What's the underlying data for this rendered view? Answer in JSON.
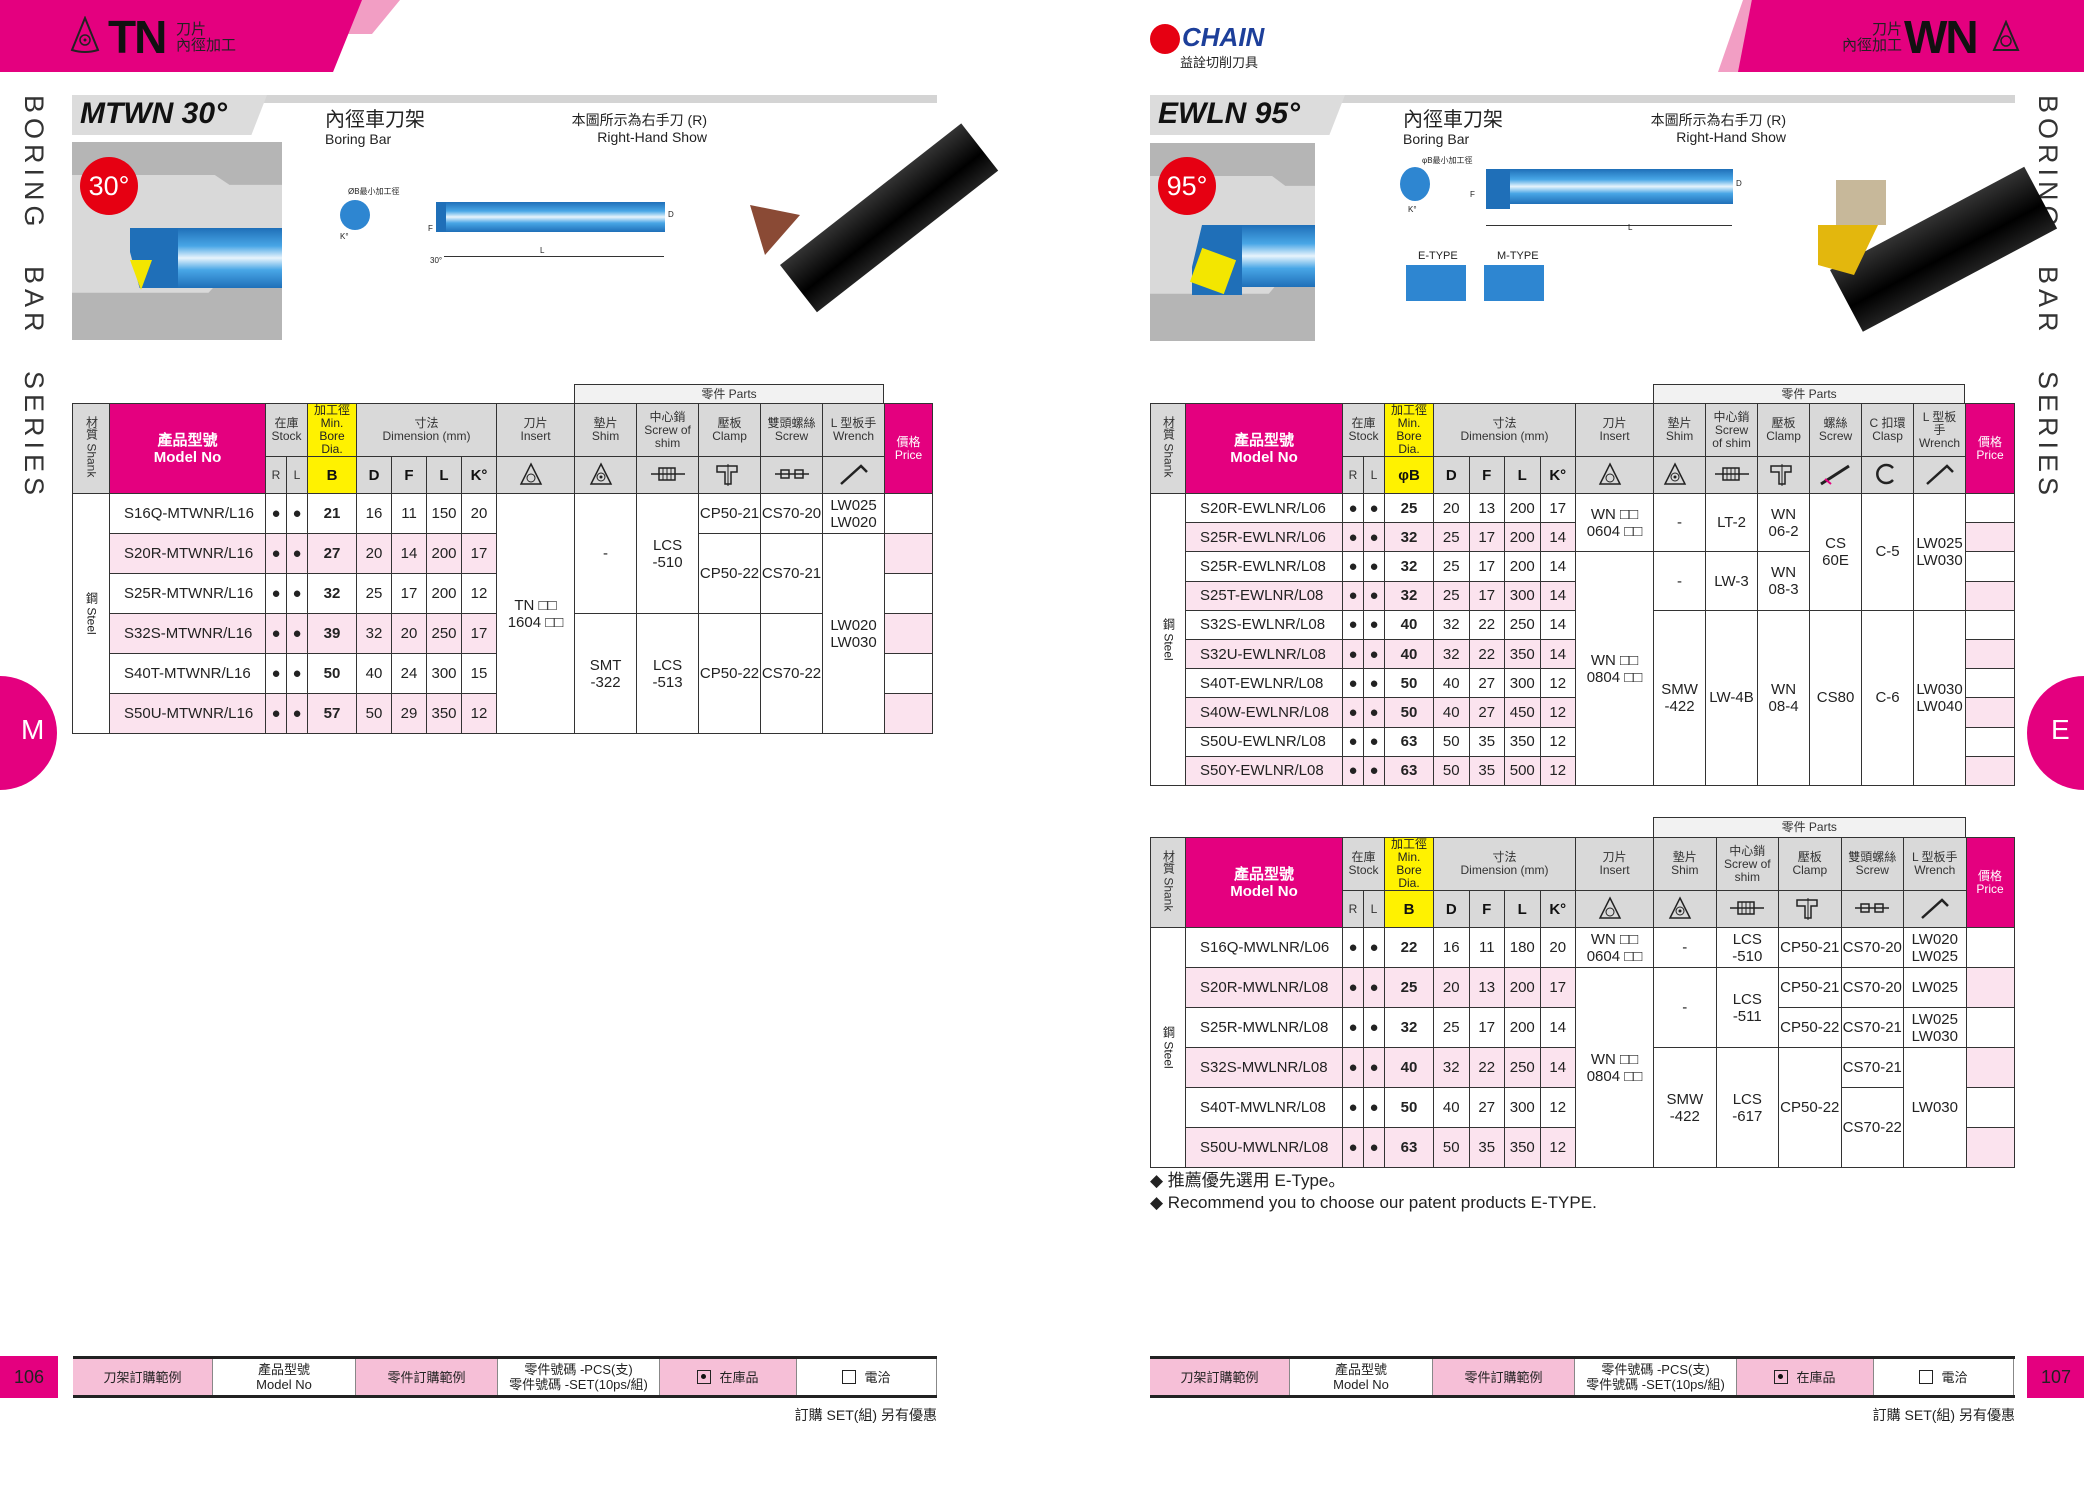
{
  "left_page": {
    "header": {
      "code": "TN",
      "line1": "刀片",
      "line2": "內徑加工",
      "icon": "tn-insert-triangle-icon"
    },
    "side_label": "BORING BAR SERIES",
    "section_letter": "M",
    "title": "MTWN 30°",
    "product_zh": "內徑車刀架",
    "product_en": "Boring Bar",
    "hand_zh": "本圖所示為右手刀 (R)",
    "hand_en": "Right-Hand Show",
    "angle_badge": "30°",
    "diagram": {
      "bore_note": "ØB最小加工徑",
      "d": "D",
      "f": "F",
      "l": "L",
      "k": "K°",
      "angle": "30°"
    },
    "page_number": "106"
  },
  "right_page": {
    "brand": {
      "name": "CHAIN",
      "tagline": "益詮切削刀具"
    },
    "header": {
      "code": "WN",
      "line1": "刀片",
      "line2": "內徑加工",
      "icon": "wn-insert-icon"
    },
    "side_label": "BORING BAR SERIES",
    "section_letter": "E",
    "title": "EWLN 95°",
    "product_zh": "內徑車刀架",
    "product_en": "Boring Bar",
    "hand_zh": "本圖所示為右手刀 (R)",
    "hand_en": "Right-Hand Show",
    "angle_badge": "95°",
    "diagram": {
      "bore_note": "φB最小加工徑",
      "d": "D",
      "f": "F",
      "l": "L",
      "k": "K°",
      "e_type": "E-TYPE",
      "m_type": "M-TYPE"
    },
    "notes": [
      "◆ 推薦優先選用 E-Type。",
      "◆ Recommend you to choose our patent products E-TYPE."
    ],
    "page_number": "107"
  },
  "footer": {
    "cells": [
      "刀架訂購範例",
      "產品型號\nModel No",
      "零件訂購範例",
      "零件號碼 -PCS(支)\n零件號碼 -SET(10ps/組)",
      "在庫品",
      "電洽"
    ],
    "set_note": "訂購 SET(組) 另有優惠"
  },
  "tables": [
    {
      "id": "mtwn",
      "header": {
        "shank": "材質 Shank",
        "model_zh": "產品型號",
        "model_en": "Model No",
        "stock": "在庫\nStock",
        "bore": "加工徑\nMin. Bore\nDia.",
        "dim": "寸法\nDimension (mm)",
        "insert": "刀片\nInsert",
        "r": "R",
        "l": "L",
        "b": "B",
        "d": "D",
        "f": "F",
        "L": "L",
        "k": "K°",
        "price": "價格\nPrice",
        "parts_label": "零件 Parts"
      },
      "parts_cols": [
        {
          "key": "shim",
          "label": "墊片\nShim",
          "icon": "shim-icon"
        },
        {
          "key": "screw_of_shim",
          "label": "中心銷\nScrew of\nshim",
          "icon": "shim-screw-icon"
        },
        {
          "key": "clamp",
          "label": "壓板\nClamp",
          "icon": "clamp-icon"
        },
        {
          "key": "screw",
          "label": "雙頭螺絲\nScrew",
          "icon": "double-screw-icon"
        },
        {
          "key": "wrench",
          "label": "L 型板手\nWrench",
          "icon": "wrench-icon"
        }
      ],
      "shank_body": "鋼 Steel",
      "rows": [
        {
          "model": "S16Q-MTWNR/L16",
          "r": "●",
          "l": "●",
          "b": "21",
          "d": "16",
          "f": "11",
          "L": "150",
          "k": "20"
        },
        {
          "model": "S20R-MTWNR/L16",
          "r": "●",
          "l": "●",
          "b": "27",
          "d": "20",
          "f": "14",
          "L": "200",
          "k": "17"
        },
        {
          "model": "S25R-MTWNR/L16",
          "r": "●",
          "l": "●",
          "b": "32",
          "d": "25",
          "f": "17",
          "L": "200",
          "k": "12"
        },
        {
          "model": "S32S-MTWNR/L16",
          "r": "●",
          "l": "●",
          "b": "39",
          "d": "32",
          "f": "20",
          "L": "250",
          "k": "17"
        },
        {
          "model": "S40T-MTWNR/L16",
          "r": "●",
          "l": "●",
          "b": "50",
          "d": "40",
          "f": "24",
          "L": "300",
          "k": "15"
        },
        {
          "model": "S50U-MTWNR/L16",
          "r": "●",
          "l": "●",
          "b": "57",
          "d": "50",
          "f": "29",
          "L": "350",
          "k": "12"
        }
      ],
      "insert": [
        {
          "value": "TN □□\n1604 □□",
          "span": 6
        }
      ],
      "parts": {
        "shim": [
          {
            "value": "-",
            "span": 3
          },
          {
            "value": "SMT\n-322",
            "span": 3
          }
        ],
        "screw_of_shim": [
          {
            "value": "LCS\n-510",
            "span": 3
          },
          {
            "value": "LCS\n-513",
            "span": 3
          }
        ],
        "clamp": [
          {
            "value": "CP50-21",
            "span": 1
          },
          {
            "value": "CP50-22",
            "span": 2
          },
          {
            "value": "CP50-22",
            "span": 3
          }
        ],
        "screw": [
          {
            "value": "CS70-20",
            "span": 1
          },
          {
            "value": "CS70-21",
            "span": 2
          },
          {
            "value": "CS70-22",
            "span": 3
          }
        ],
        "wrench": [
          {
            "value": "LW025\nLW020",
            "span": 1
          },
          {
            "value": "LW020\nLW030",
            "span": 5
          }
        ]
      }
    },
    {
      "id": "ewln",
      "header": {
        "shank": "材質 Shank",
        "model_zh": "產品型號",
        "model_en": "Model No",
        "stock": "在庫\nStock",
        "bore": "加工徑\nMin. Bore\nDia.",
        "dim": "寸法\nDimension (mm)",
        "insert": "刀片\nInsert",
        "r": "R",
        "l": "L",
        "b": "φB",
        "d": "D",
        "f": "F",
        "L": "L",
        "k": "K°",
        "price": "價格\nPrice",
        "parts_label": "零件 Parts"
      },
      "parts_cols": [
        {
          "key": "shim",
          "label": "墊片\nShim",
          "icon": "shim-icon"
        },
        {
          "key": "screw_of_shim",
          "label": "中心銷\nScrew\nof shim",
          "icon": "shim-screw-icon"
        },
        {
          "key": "clamp",
          "label": "壓板\nClamp",
          "icon": "clamp-icon"
        },
        {
          "key": "screw",
          "label": "螺絲\nScrew",
          "icon": "screw-icon"
        },
        {
          "key": "clasp",
          "label": "C 扣環\nClasp",
          "icon": "clasp-icon"
        },
        {
          "key": "wrench",
          "label": "L 型板\n手\nWrench",
          "icon": "wrench-icon"
        }
      ],
      "shank_body": "鋼 Steel",
      "rows": [
        {
          "model": "S20R-EWLNR/L06",
          "r": "●",
          "l": "●",
          "b": "25",
          "d": "20",
          "f": "13",
          "L": "200",
          "k": "17"
        },
        {
          "model": "S25R-EWLNR/L06",
          "r": "●",
          "l": "●",
          "b": "32",
          "d": "25",
          "f": "17",
          "L": "200",
          "k": "14"
        },
        {
          "model": "S25R-EWLNR/L08",
          "r": "●",
          "l": "●",
          "b": "32",
          "d": "25",
          "f": "17",
          "L": "200",
          "k": "14"
        },
        {
          "model": "S25T-EWLNR/L08",
          "r": "●",
          "l": "●",
          "b": "32",
          "d": "25",
          "f": "17",
          "L": "300",
          "k": "14"
        },
        {
          "model": "S32S-EWLNR/L08",
          "r": "●",
          "l": "●",
          "b": "40",
          "d": "32",
          "f": "22",
          "L": "250",
          "k": "14"
        },
        {
          "model": "S32U-EWLNR/L08",
          "r": "●",
          "l": "●",
          "b": "40",
          "d": "32",
          "f": "22",
          "L": "350",
          "k": "14"
        },
        {
          "model": "S40T-EWLNR/L08",
          "r": "●",
          "l": "●",
          "b": "50",
          "d": "40",
          "f": "27",
          "L": "300",
          "k": "12"
        },
        {
          "model": "S40W-EWLNR/L08",
          "r": "●",
          "l": "●",
          "b": "50",
          "d": "40",
          "f": "27",
          "L": "450",
          "k": "12"
        },
        {
          "model": "S50U-EWLNR/L08",
          "r": "●",
          "l": "●",
          "b": "63",
          "d": "50",
          "f": "35",
          "L": "350",
          "k": "12"
        },
        {
          "model": "S50Y-EWLNR/L08",
          "r": "●",
          "l": "●",
          "b": "63",
          "d": "50",
          "f": "35",
          "L": "500",
          "k": "12"
        }
      ],
      "insert": [
        {
          "value": "WN □□\n0604 □□",
          "span": 2
        },
        {
          "value": "WN □□\n0804 □□",
          "span": 8
        }
      ],
      "parts": {
        "shim": [
          {
            "value": "-",
            "span": 2
          },
          {
            "value": "-",
            "span": 2
          },
          {
            "value": "SMW\n-422",
            "span": 6
          }
        ],
        "screw_of_shim": [
          {
            "value": "LT-2",
            "span": 2
          },
          {
            "value": "LW-3",
            "span": 2
          },
          {
            "value": "LW-4B",
            "span": 6
          }
        ],
        "clamp": [
          {
            "value": "WN\n06-2",
            "span": 2
          },
          {
            "value": "WN\n08-3",
            "span": 2
          },
          {
            "value": "WN\n08-4",
            "span": 6
          }
        ],
        "screw": [
          {
            "value": "CS\n60E",
            "span": 4
          },
          {
            "value": "CS80",
            "span": 6
          }
        ],
        "clasp": [
          {
            "value": "C-5",
            "span": 4
          },
          {
            "value": "C-6",
            "span": 6
          }
        ],
        "wrench": [
          {
            "value": "LW025\nLW030",
            "span": 4
          },
          {
            "value": "LW030\nLW040",
            "span": 6
          }
        ]
      }
    },
    {
      "id": "mwln",
      "header": {
        "shank": "材質 Shank",
        "model_zh": "產品型號",
        "model_en": "Model No",
        "stock": "在庫\nStock",
        "bore": "加工徑\nMin. Bore\nDia.",
        "dim": "寸法\nDimension (mm)",
        "insert": "刀片\nInsert",
        "r": "R",
        "l": "L",
        "b": "B",
        "d": "D",
        "f": "F",
        "L": "L",
        "k": "K°",
        "price": "價格\nPrice",
        "parts_label": "零件 Parts"
      },
      "parts_cols": [
        {
          "key": "shim",
          "label": "墊片\nShim",
          "icon": "shim-icon"
        },
        {
          "key": "screw_of_shim",
          "label": "中心銷\nScrew of\nshim",
          "icon": "shim-screw-icon"
        },
        {
          "key": "clamp",
          "label": "壓板\nClamp",
          "icon": "clamp-icon"
        },
        {
          "key": "screw",
          "label": "雙頭螺絲\nScrew",
          "icon": "double-screw-icon"
        },
        {
          "key": "wrench",
          "label": "L 型板手\nWrench",
          "icon": "wrench-icon"
        }
      ],
      "shank_body": "鋼 Steel",
      "rows": [
        {
          "model": "S16Q-MWLNR/L06",
          "r": "●",
          "l": "●",
          "b": "22",
          "d": "16",
          "f": "11",
          "L": "180",
          "k": "20"
        },
        {
          "model": "S20R-MWLNR/L08",
          "r": "●",
          "l": "●",
          "b": "25",
          "d": "20",
          "f": "13",
          "L": "200",
          "k": "17"
        },
        {
          "model": "S25R-MWLNR/L08",
          "r": "●",
          "l": "●",
          "b": "32",
          "d": "25",
          "f": "17",
          "L": "200",
          "k": "14"
        },
        {
          "model": "S32S-MWLNR/L08",
          "r": "●",
          "l": "●",
          "b": "40",
          "d": "32",
          "f": "22",
          "L": "250",
          "k": "14"
        },
        {
          "model": "S40T-MWLNR/L08",
          "r": "●",
          "l": "●",
          "b": "50",
          "d": "40",
          "f": "27",
          "L": "300",
          "k": "12"
        },
        {
          "model": "S50U-MWLNR/L08",
          "r": "●",
          "l": "●",
          "b": "63",
          "d": "50",
          "f": "35",
          "L": "350",
          "k": "12"
        }
      ],
      "insert": [
        {
          "value": "WN □□\n0604 □□",
          "span": 1
        },
        {
          "value": "WN □□\n0804 □□",
          "span": 5
        }
      ],
      "parts": {
        "shim": [
          {
            "value": "-",
            "span": 1
          },
          {
            "value": "-",
            "span": 2
          },
          {
            "value": "SMW\n-422",
            "span": 3
          }
        ],
        "screw_of_shim": [
          {
            "value": "LCS\n-510",
            "span": 1
          },
          {
            "value": "LCS\n-511",
            "span": 2
          },
          {
            "value": "LCS\n-617",
            "span": 3
          }
        ],
        "clamp": [
          {
            "value": "CP50-21",
            "span": 1
          },
          {
            "value": "CP50-21",
            "span": 1
          },
          {
            "value": "CP50-22",
            "span": 1
          },
          {
            "value": "CP50-22",
            "span": 3
          }
        ],
        "screw": [
          {
            "value": "CS70-20",
            "span": 1
          },
          {
            "value": "CS70-20",
            "span": 1
          },
          {
            "value": "CS70-21",
            "span": 1
          },
          {
            "value": "CS70-21",
            "span": 1
          },
          {
            "value": "CS70-22",
            "span": 2
          }
        ],
        "wrench": [
          {
            "value": "LW020\nLW025",
            "span": 1
          },
          {
            "value": "LW025",
            "span": 1
          },
          {
            "value": "LW025\nLW030",
            "span": 1
          },
          {
            "value": "LW030",
            "span": 3
          }
        ]
      }
    }
  ],
  "colors": {
    "brand_magenta": "#e4007f",
    "light_pink": "#f29ec4",
    "row_pink": "#fbe3ee",
    "bore_yellow": "#fff200",
    "badge_red": "#e60012",
    "bar_blue": "#1f6fb8"
  }
}
